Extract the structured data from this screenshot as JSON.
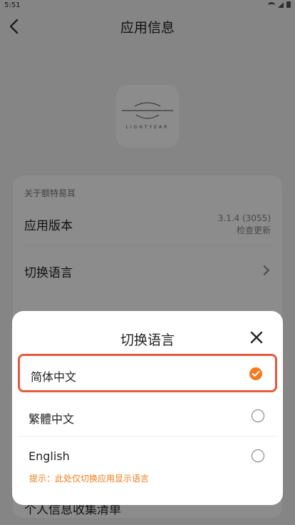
{
  "status_bar": {
    "time": "5:51"
  },
  "header": {
    "title": "应用信息"
  },
  "app_icon": {
    "wordmark": "LIGHTYEAR"
  },
  "card": {
    "section_label": "关于额特易耳",
    "version_row": {
      "label": "应用版本",
      "value": "3.1.4 (3055)",
      "action": "检查更新"
    },
    "language_row": {
      "label": "切换语言"
    },
    "partial_row": {
      "label": "个人信息收集清单"
    }
  },
  "language_sheet": {
    "title": "切换语言",
    "options": [
      {
        "label": "简体中文",
        "selected": true
      },
      {
        "label": "繁體中文",
        "selected": false
      },
      {
        "label": "English",
        "selected": false
      }
    ],
    "hint": "提示：此处仅切换应用显示语言"
  },
  "colors": {
    "accent": "#f57a1f",
    "highlight_border": "#e45a3d",
    "overlay": "rgba(0,0,0,0.45)"
  },
  "icons": [
    "back-arrow",
    "chevron-right",
    "close-x",
    "check",
    "wifi",
    "signal",
    "battery"
  ]
}
